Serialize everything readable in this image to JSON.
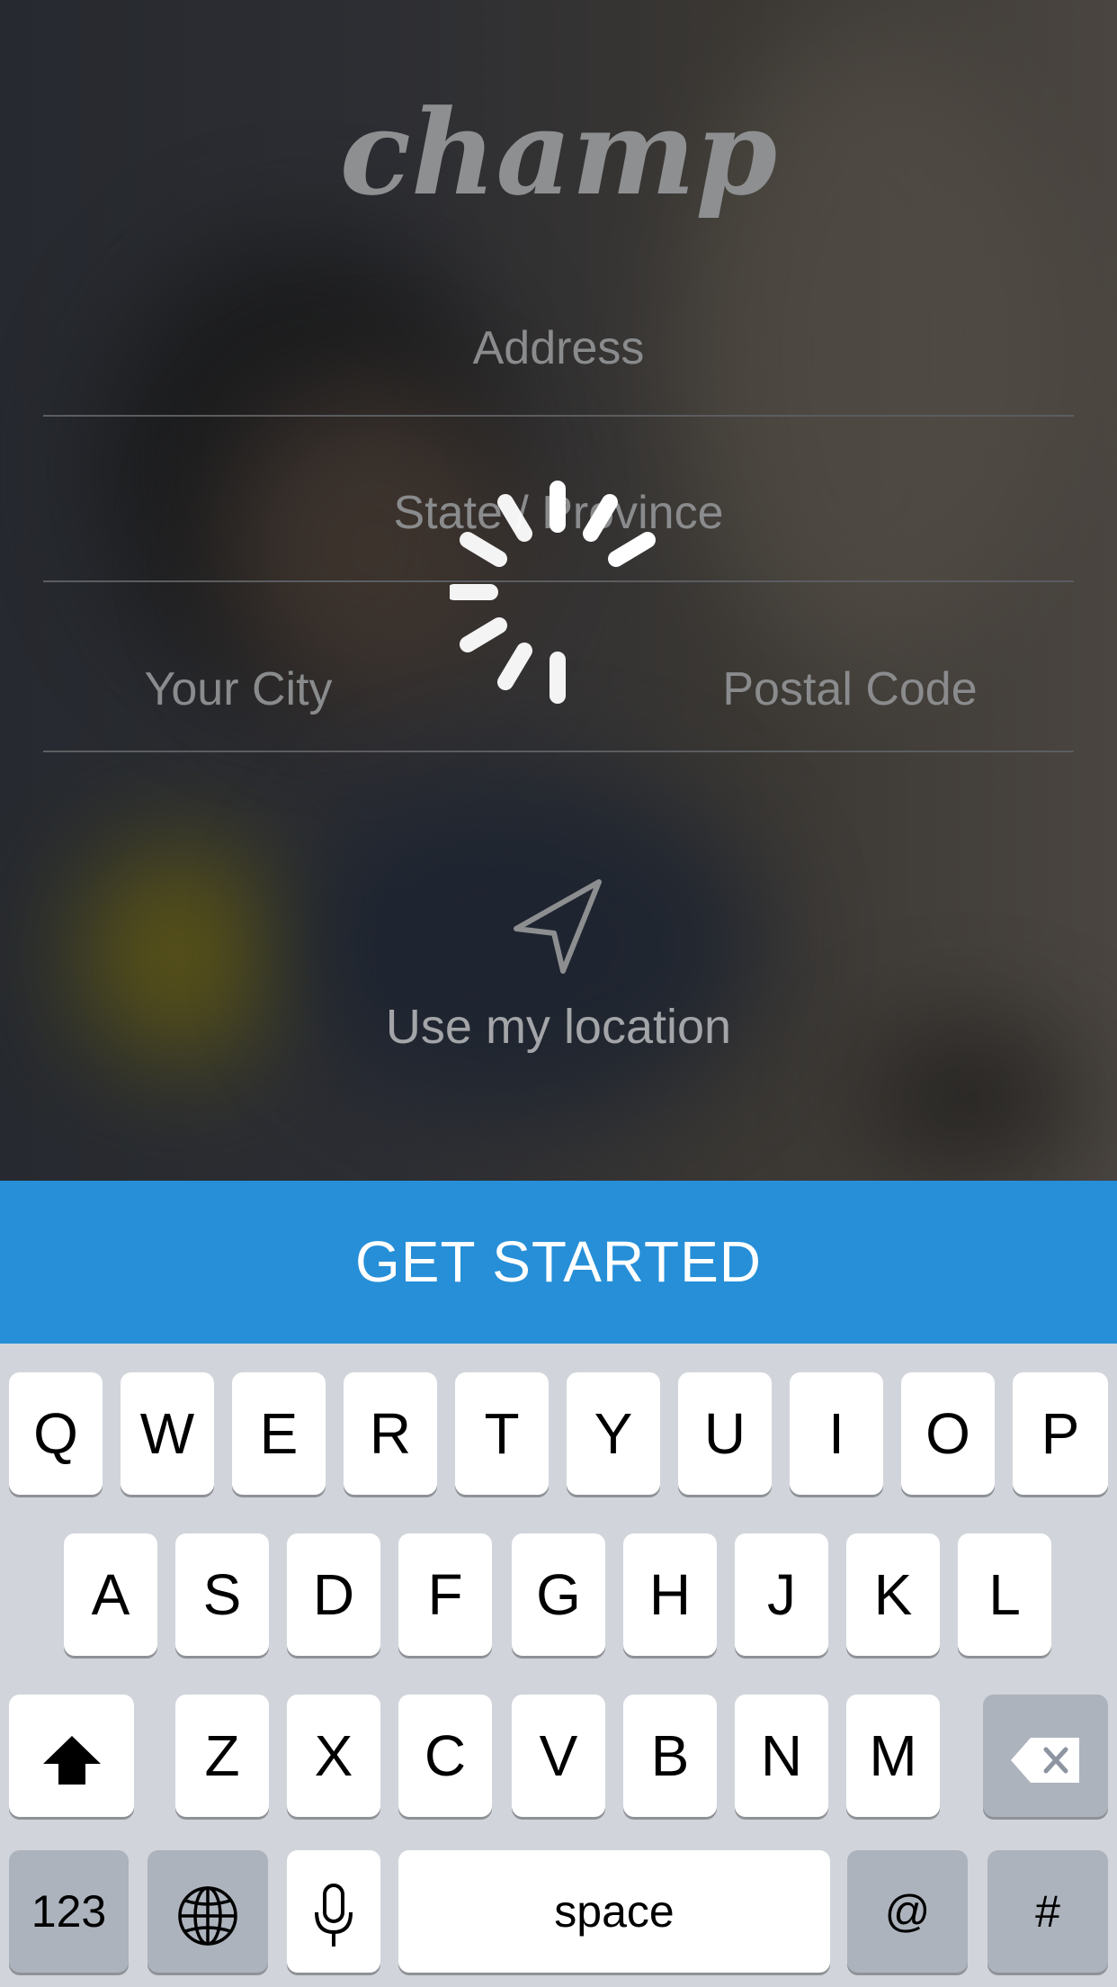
{
  "app": {
    "logo": "champ"
  },
  "form": {
    "address_placeholder": "Address",
    "state_placeholder": "State / Province",
    "city_placeholder": "Your City",
    "postal_placeholder": "Postal Code",
    "location_label": "Use my location"
  },
  "cta": {
    "label": "GET STARTED"
  },
  "keyboard": {
    "row1": [
      "Q",
      "W",
      "E",
      "R",
      "T",
      "Y",
      "U",
      "I",
      "O",
      "P"
    ],
    "row2": [
      "A",
      "S",
      "D",
      "F",
      "G",
      "H",
      "J",
      "K",
      "L"
    ],
    "row3": [
      "Z",
      "X",
      "C",
      "V",
      "B",
      "N",
      "M"
    ],
    "numbers_key": "123",
    "space_key": "space",
    "at_key": "@",
    "hash_key": "#"
  },
  "icons": [
    "location-arrow-icon",
    "spinner-icon",
    "shift-icon",
    "backspace-icon",
    "globe-icon",
    "microphone-icon"
  ],
  "colors": {
    "accent": "#268fd8",
    "keyboard_bg": "#d1d5db"
  }
}
